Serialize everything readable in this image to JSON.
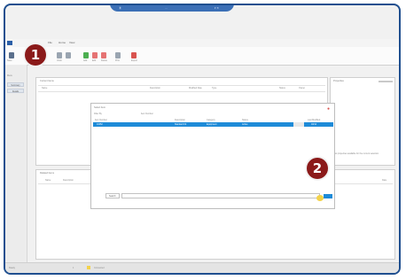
{
  "window": {
    "title_left": "Ⓡ",
    "title_center": "···",
    "title_right": "▾ ✕"
  },
  "ribbon": {
    "tabs": [
      "File",
      "Home",
      "View"
    ],
    "labels": [
      "Save",
      "Undo",
      "Add",
      "Edit",
      "Delete",
      "Print",
      "Export"
    ]
  },
  "nav": {
    "header": "Menu",
    "items": [
      "Summary",
      "Details"
    ]
  },
  "top_panel": {
    "header": "Current Items",
    "columns": [
      "Name",
      "Description",
      "Modified Date",
      "Type",
      "Status",
      "Owner"
    ]
  },
  "right_panel": {
    "header": "Properties",
    "note": "No properties available for the current selection"
  },
  "dialog": {
    "title": "Select Item",
    "filter_label": "Filter By",
    "filter_value": "Item Number",
    "columns": [
      "Item Number",
      "Description",
      "Category",
      "Status",
      "Last Modified"
    ],
    "selected_row": [
      "10452",
      "Standard Kit",
      "Equipment",
      "Active",
      "03/14"
    ],
    "search_label": "Search",
    "search_value": "",
    "close_glyph": "●"
  },
  "bottom_panel": {
    "header": "Related Items",
    "columns": [
      "Name",
      "Description",
      "Date"
    ]
  },
  "status": {
    "left": "Ready",
    "page": "1",
    "user": "Connected"
  },
  "callouts": [
    "1",
    "2"
  ],
  "colors": {
    "accent": "#1e8bd8",
    "frame": "#1f4f8f",
    "callout": "#8b1a1a",
    "highlight": "#f3d24a",
    "close_dot": "#d9534f"
  }
}
